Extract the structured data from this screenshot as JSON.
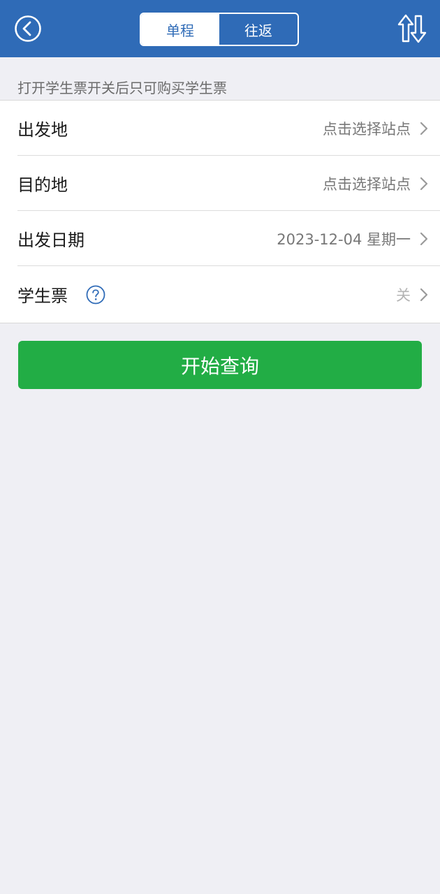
{
  "header": {
    "back_icon": "back-circle-icon",
    "swap_icon": "swap-arrows-icon",
    "tabs": [
      {
        "label": "单程",
        "active": true
      },
      {
        "label": "往返",
        "active": false
      }
    ],
    "colors": {
      "bar": "#2f6bb7"
    }
  },
  "notice": "打开学生票开关后只可购买学生票",
  "form": {
    "rows": [
      {
        "label": "出发地",
        "value": "点击选择站点"
      },
      {
        "label": "目的地",
        "value": "点击选择站点"
      },
      {
        "label": "出发日期",
        "value": "2023-12-04 星期一"
      },
      {
        "label": "学生票",
        "value": "关",
        "help_icon": "help-question-icon"
      }
    ]
  },
  "search_button": {
    "label": "开始查询",
    "color": "#22ad45"
  }
}
